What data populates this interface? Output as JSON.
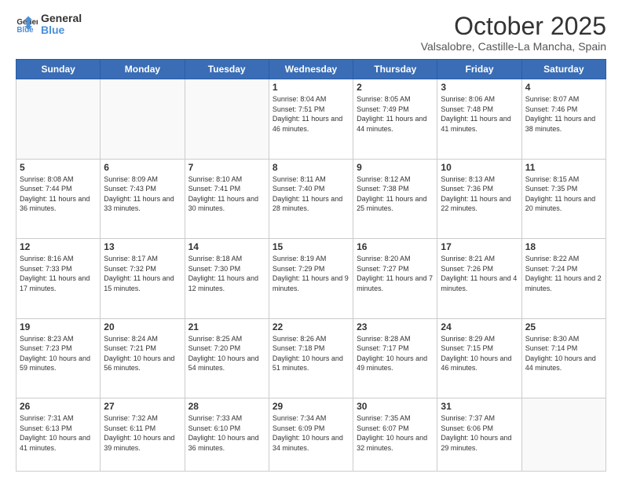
{
  "logo": {
    "line1": "General",
    "line2": "Blue"
  },
  "header": {
    "month": "October 2025",
    "location": "Valsalobre, Castille-La Mancha, Spain"
  },
  "weekdays": [
    "Sunday",
    "Monday",
    "Tuesday",
    "Wednesday",
    "Thursday",
    "Friday",
    "Saturday"
  ],
  "weeks": [
    [
      {
        "day": "",
        "info": ""
      },
      {
        "day": "",
        "info": ""
      },
      {
        "day": "",
        "info": ""
      },
      {
        "day": "1",
        "info": "Sunrise: 8:04 AM\nSunset: 7:51 PM\nDaylight: 11 hours and 46 minutes."
      },
      {
        "day": "2",
        "info": "Sunrise: 8:05 AM\nSunset: 7:49 PM\nDaylight: 11 hours and 44 minutes."
      },
      {
        "day": "3",
        "info": "Sunrise: 8:06 AM\nSunset: 7:48 PM\nDaylight: 11 hours and 41 minutes."
      },
      {
        "day": "4",
        "info": "Sunrise: 8:07 AM\nSunset: 7:46 PM\nDaylight: 11 hours and 38 minutes."
      }
    ],
    [
      {
        "day": "5",
        "info": "Sunrise: 8:08 AM\nSunset: 7:44 PM\nDaylight: 11 hours and 36 minutes."
      },
      {
        "day": "6",
        "info": "Sunrise: 8:09 AM\nSunset: 7:43 PM\nDaylight: 11 hours and 33 minutes."
      },
      {
        "day": "7",
        "info": "Sunrise: 8:10 AM\nSunset: 7:41 PM\nDaylight: 11 hours and 30 minutes."
      },
      {
        "day": "8",
        "info": "Sunrise: 8:11 AM\nSunset: 7:40 PM\nDaylight: 11 hours and 28 minutes."
      },
      {
        "day": "9",
        "info": "Sunrise: 8:12 AM\nSunset: 7:38 PM\nDaylight: 11 hours and 25 minutes."
      },
      {
        "day": "10",
        "info": "Sunrise: 8:13 AM\nSunset: 7:36 PM\nDaylight: 11 hours and 22 minutes."
      },
      {
        "day": "11",
        "info": "Sunrise: 8:15 AM\nSunset: 7:35 PM\nDaylight: 11 hours and 20 minutes."
      }
    ],
    [
      {
        "day": "12",
        "info": "Sunrise: 8:16 AM\nSunset: 7:33 PM\nDaylight: 11 hours and 17 minutes."
      },
      {
        "day": "13",
        "info": "Sunrise: 8:17 AM\nSunset: 7:32 PM\nDaylight: 11 hours and 15 minutes."
      },
      {
        "day": "14",
        "info": "Sunrise: 8:18 AM\nSunset: 7:30 PM\nDaylight: 11 hours and 12 minutes."
      },
      {
        "day": "15",
        "info": "Sunrise: 8:19 AM\nSunset: 7:29 PM\nDaylight: 11 hours and 9 minutes."
      },
      {
        "day": "16",
        "info": "Sunrise: 8:20 AM\nSunset: 7:27 PM\nDaylight: 11 hours and 7 minutes."
      },
      {
        "day": "17",
        "info": "Sunrise: 8:21 AM\nSunset: 7:26 PM\nDaylight: 11 hours and 4 minutes."
      },
      {
        "day": "18",
        "info": "Sunrise: 8:22 AM\nSunset: 7:24 PM\nDaylight: 11 hours and 2 minutes."
      }
    ],
    [
      {
        "day": "19",
        "info": "Sunrise: 8:23 AM\nSunset: 7:23 PM\nDaylight: 10 hours and 59 minutes."
      },
      {
        "day": "20",
        "info": "Sunrise: 8:24 AM\nSunset: 7:21 PM\nDaylight: 10 hours and 56 minutes."
      },
      {
        "day": "21",
        "info": "Sunrise: 8:25 AM\nSunset: 7:20 PM\nDaylight: 10 hours and 54 minutes."
      },
      {
        "day": "22",
        "info": "Sunrise: 8:26 AM\nSunset: 7:18 PM\nDaylight: 10 hours and 51 minutes."
      },
      {
        "day": "23",
        "info": "Sunrise: 8:28 AM\nSunset: 7:17 PM\nDaylight: 10 hours and 49 minutes."
      },
      {
        "day": "24",
        "info": "Sunrise: 8:29 AM\nSunset: 7:15 PM\nDaylight: 10 hours and 46 minutes."
      },
      {
        "day": "25",
        "info": "Sunrise: 8:30 AM\nSunset: 7:14 PM\nDaylight: 10 hours and 44 minutes."
      }
    ],
    [
      {
        "day": "26",
        "info": "Sunrise: 7:31 AM\nSunset: 6:13 PM\nDaylight: 10 hours and 41 minutes."
      },
      {
        "day": "27",
        "info": "Sunrise: 7:32 AM\nSunset: 6:11 PM\nDaylight: 10 hours and 39 minutes."
      },
      {
        "day": "28",
        "info": "Sunrise: 7:33 AM\nSunset: 6:10 PM\nDaylight: 10 hours and 36 minutes."
      },
      {
        "day": "29",
        "info": "Sunrise: 7:34 AM\nSunset: 6:09 PM\nDaylight: 10 hours and 34 minutes."
      },
      {
        "day": "30",
        "info": "Sunrise: 7:35 AM\nSunset: 6:07 PM\nDaylight: 10 hours and 32 minutes."
      },
      {
        "day": "31",
        "info": "Sunrise: 7:37 AM\nSunset: 6:06 PM\nDaylight: 10 hours and 29 minutes."
      },
      {
        "day": "",
        "info": ""
      }
    ]
  ]
}
